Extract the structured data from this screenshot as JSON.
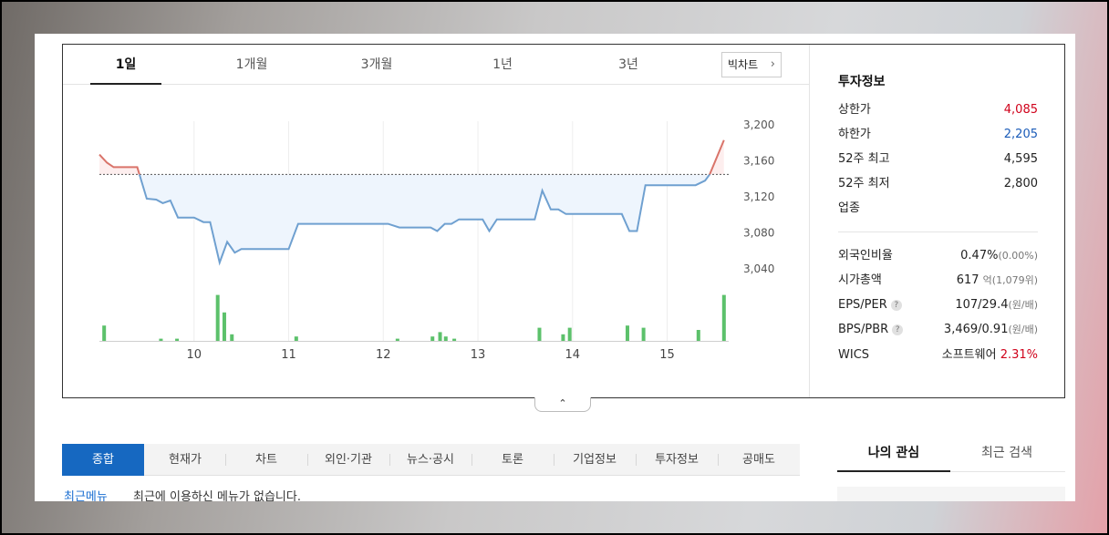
{
  "period_tabs": [
    {
      "label": "1일",
      "active": true
    },
    {
      "label": "1개월",
      "active": false
    },
    {
      "label": "3개월",
      "active": false
    },
    {
      "label": "1년",
      "active": false
    },
    {
      "label": "3년",
      "active": false
    }
  ],
  "big_chart_label": "빅차트",
  "chart_data": {
    "type": "line",
    "y_ticks": [
      "3,200",
      "3,160",
      "3,120",
      "3,080",
      "3,040"
    ],
    "ylim": [
      3040,
      3200
    ],
    "x_ticks": [
      "10",
      "11",
      "12",
      "13",
      "14",
      "15"
    ],
    "reference_price": 3145,
    "price_series": [
      [
        9.0,
        3167
      ],
      [
        9.08,
        3158
      ],
      [
        9.15,
        3153
      ],
      [
        9.4,
        3153
      ],
      [
        9.5,
        3118
      ],
      [
        9.6,
        3117
      ],
      [
        9.67,
        3113
      ],
      [
        9.75,
        3116
      ],
      [
        9.83,
        3097
      ],
      [
        10.0,
        3097
      ],
      [
        10.1,
        3092
      ],
      [
        10.17,
        3092
      ],
      [
        10.27,
        3047
      ],
      [
        10.35,
        3070
      ],
      [
        10.43,
        3058
      ],
      [
        10.5,
        3062
      ],
      [
        11.0,
        3062
      ],
      [
        11.1,
        3090
      ],
      [
        12.05,
        3090
      ],
      [
        12.17,
        3086
      ],
      [
        12.5,
        3086
      ],
      [
        12.57,
        3082
      ],
      [
        12.65,
        3090
      ],
      [
        12.72,
        3090
      ],
      [
        12.8,
        3095
      ],
      [
        13.05,
        3095
      ],
      [
        13.12,
        3082
      ],
      [
        13.2,
        3095
      ],
      [
        13.6,
        3095
      ],
      [
        13.68,
        3127
      ],
      [
        13.77,
        3106
      ],
      [
        13.85,
        3106
      ],
      [
        13.93,
        3101
      ],
      [
        14.52,
        3101
      ],
      [
        14.6,
        3082
      ],
      [
        14.68,
        3082
      ],
      [
        14.77,
        3133
      ],
      [
        15.3,
        3133
      ],
      [
        15.4,
        3138
      ],
      [
        15.45,
        3145
      ],
      [
        15.6,
        3183
      ]
    ],
    "volume_series": [
      [
        9.05,
        0.07
      ],
      [
        9.65,
        0.01
      ],
      [
        9.82,
        0.01
      ],
      [
        10.25,
        0.21
      ],
      [
        10.32,
        0.13
      ],
      [
        10.4,
        0.03
      ],
      [
        11.08,
        0.02
      ],
      [
        12.15,
        0.01
      ],
      [
        12.52,
        0.02
      ],
      [
        12.6,
        0.04
      ],
      [
        12.66,
        0.02
      ],
      [
        12.75,
        0.01
      ],
      [
        13.65,
        0.06
      ],
      [
        13.9,
        0.03
      ],
      [
        13.97,
        0.06
      ],
      [
        14.58,
        0.07
      ],
      [
        14.75,
        0.06
      ],
      [
        15.33,
        0.05
      ],
      [
        15.6,
        0.21
      ]
    ],
    "colors": {
      "below": "#6fa0d0",
      "above": "#d9746a",
      "volume": "#5cc16b",
      "fill_below": "#eef5fd",
      "fill_above": "#fdeeee"
    }
  },
  "invest": {
    "title": "투자정보",
    "upper_limit_label": "상한가",
    "upper_limit_value": "4,085",
    "lower_limit_label": "하한가",
    "lower_limit_value": "2,205",
    "w52_high_label": "52주 최고",
    "w52_high_value": "4,595",
    "w52_low_label": "52주 최저",
    "w52_low_value": "2,800",
    "industry_label": "업종",
    "foreign_label": "외국인비율",
    "foreign_value": "0.47%",
    "foreign_sub": "(0.00%)",
    "mktcap_label": "시가총액",
    "mktcap_value": "617",
    "mktcap_unit": "억",
    "mktcap_sub": "(1,079위)",
    "eps_label": "EPS/PER",
    "eps_value": "107/29.4",
    "eps_unit": "(원/배)",
    "bps_label": "BPS/PBR",
    "bps_value": "3,469/0.91",
    "bps_unit": "(원/배)",
    "wics_label": "WICS",
    "wics_value": "소프트웨어",
    "wics_change": "2.31%",
    "help_glyph": "?"
  },
  "collapse_glyph": "⌃",
  "menu_tabs": [
    "종합",
    "현재가",
    "차트",
    "외인·기관",
    "뉴스·공시",
    "토론",
    "기업정보",
    "투자정보",
    "공매도"
  ],
  "recent_menu_label": "최근메뉴",
  "recent_menu_text": "최근에 이용하신 메뉴가 없습니다.",
  "side_tabs": [
    "나의 관심",
    "최근 검색"
  ]
}
